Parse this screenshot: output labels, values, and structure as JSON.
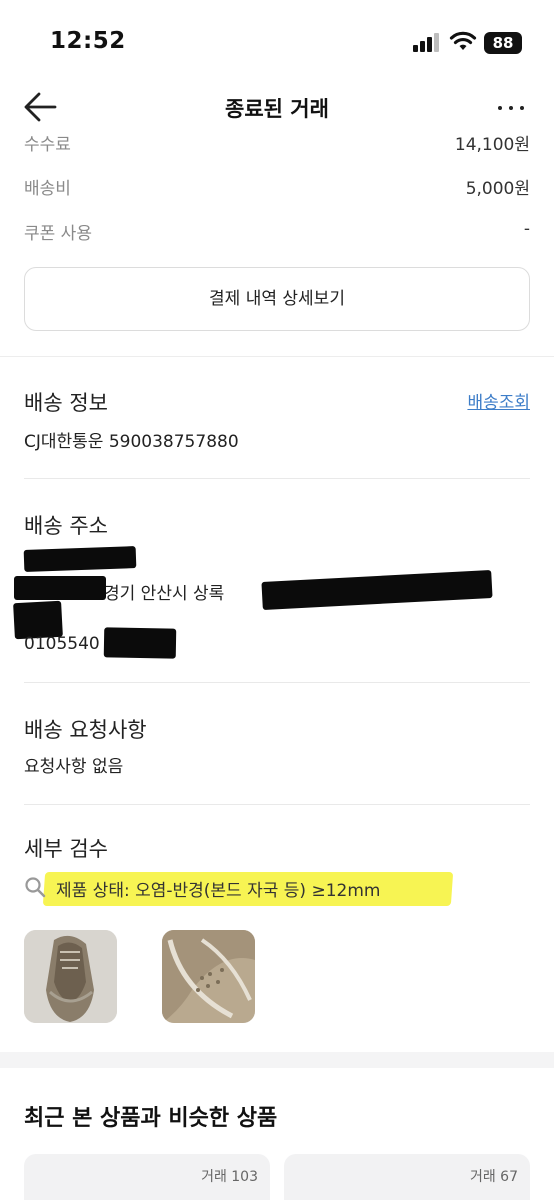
{
  "status_bar": {
    "time": "12:52",
    "battery": "88"
  },
  "nav": {
    "title": "종료된 거래"
  },
  "payment": {
    "rows": [
      {
        "label": "수수료",
        "value": "14,100원"
      },
      {
        "label": "배송비",
        "value": "5,000원"
      },
      {
        "label": "쿠폰 사용",
        "value": "-"
      }
    ],
    "detail_button": "결제 내역 상세보기"
  },
  "shipping": {
    "title": "배송 정보",
    "track_link": "배송조회",
    "carrier": "CJ대한통운 590038757880"
  },
  "address": {
    "title": "배송 주소",
    "line": "경기 안산시 상록",
    "phone": "0105540"
  },
  "request": {
    "title": "배송 요청사항",
    "text": "요청사항 없음"
  },
  "inspection": {
    "title": "세부 검수",
    "condition": "제품 상태: 오염-반경(본드 자국 등) ≥12mm"
  },
  "recent": {
    "title": "최근 본 상품과 비슷한 상품",
    "cards": [
      {
        "badge": "거래 103"
      },
      {
        "badge": "거래 67"
      }
    ]
  },
  "colors": {
    "link": "#3d7dc8",
    "highlight": "#f7f34a"
  }
}
